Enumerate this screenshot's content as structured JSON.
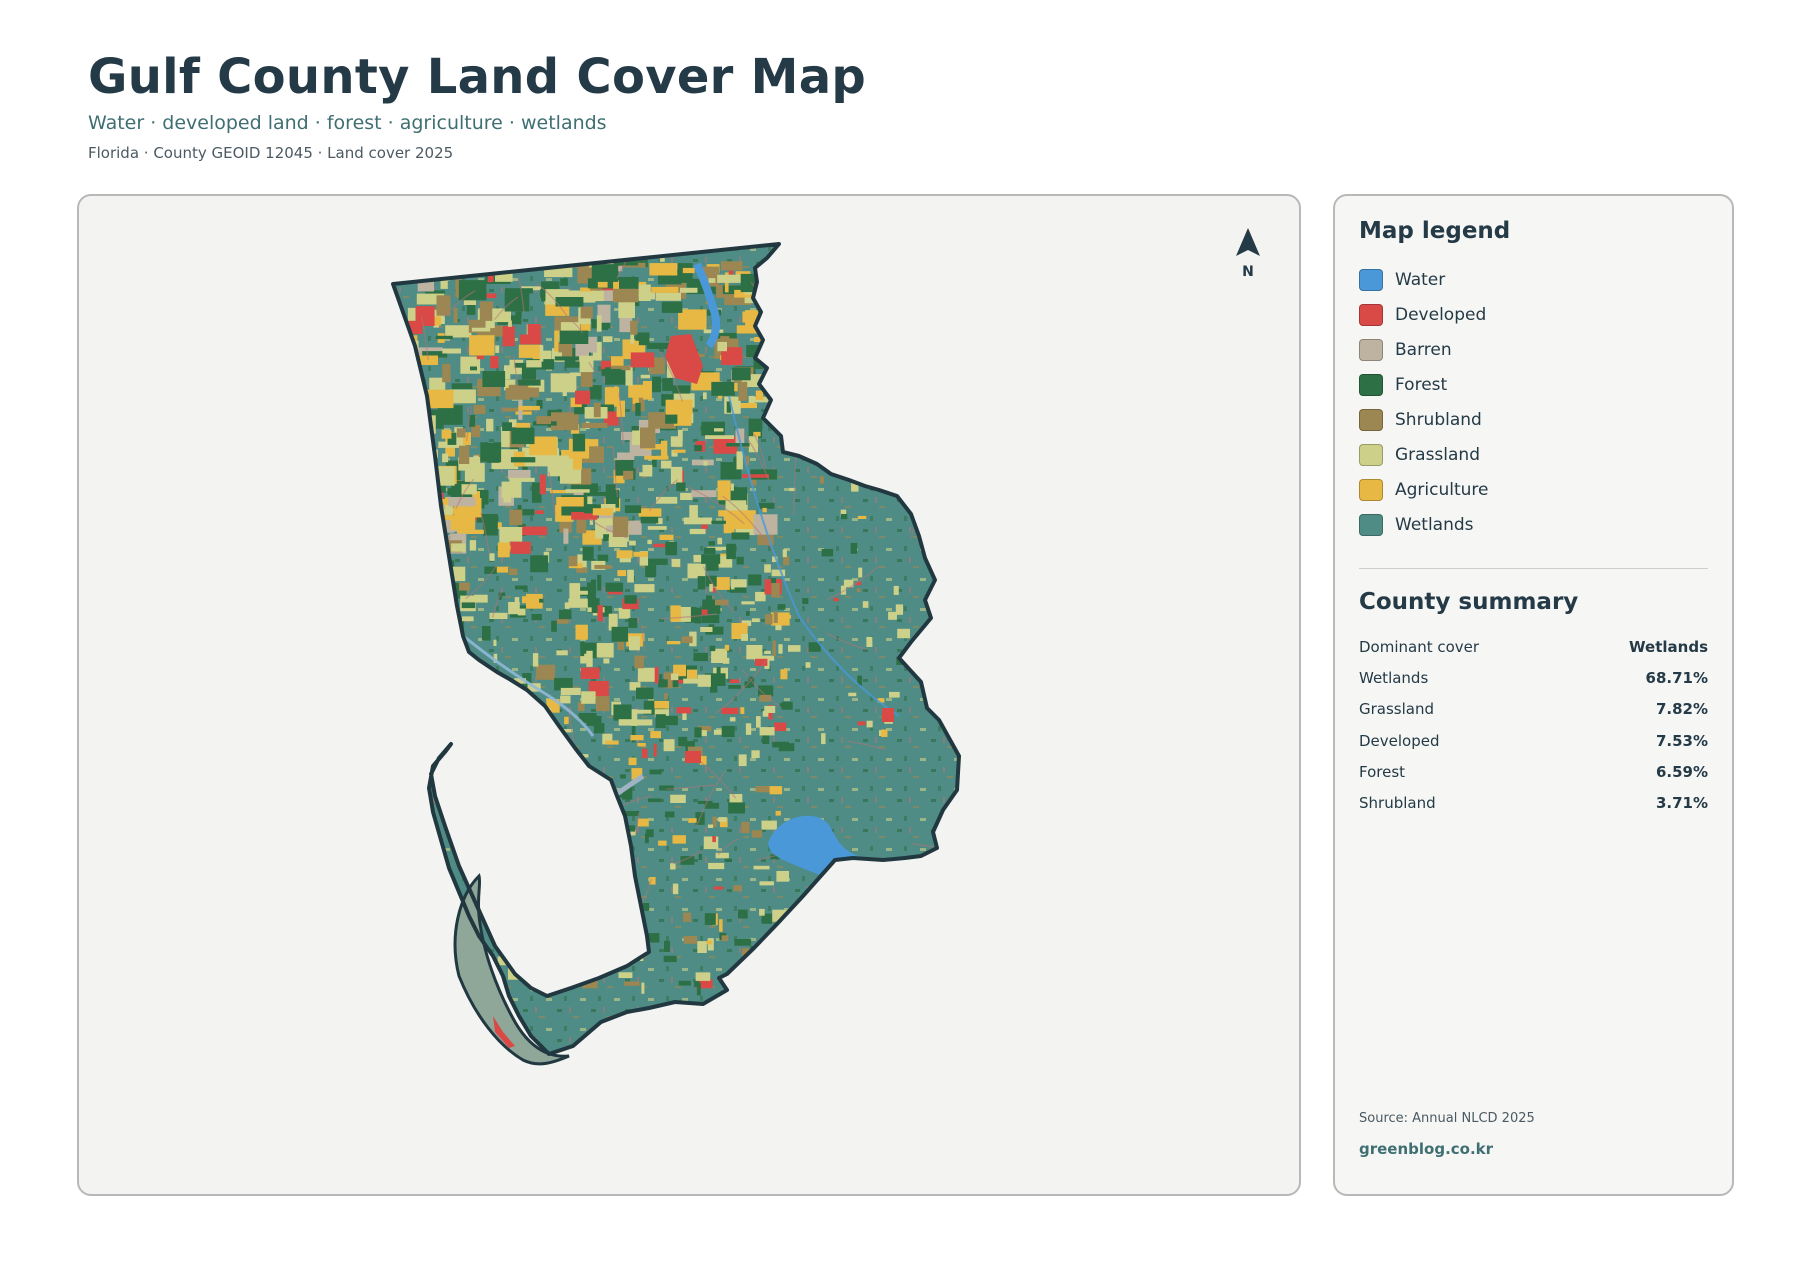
{
  "header": {
    "title": "Gulf County Land Cover Map",
    "subtitle": "Water · developed land · forest · agriculture · wetlands",
    "meta": "Florida · County GEOID 12045 · Land cover 2025"
  },
  "map": {
    "north_label": "N",
    "class_colors": {
      "water": "#4a98d8",
      "developed": "#d94a47",
      "barren": "#bdb3a0",
      "forest": "#2e7045",
      "shrubland": "#9c8752",
      "grassland": "#cdd088",
      "agriculture": "#e7b843",
      "wetlands": "#4f8c85"
    },
    "background": "#f3f3f2",
    "outline_color": "#223840"
  },
  "legend": {
    "heading": "Map legend",
    "items": [
      {
        "label": "Water",
        "color": "#4a98d8"
      },
      {
        "label": "Developed",
        "color": "#d94a47"
      },
      {
        "label": "Barren",
        "color": "#bdb3a0"
      },
      {
        "label": "Forest",
        "color": "#2e7045"
      },
      {
        "label": "Shrubland",
        "color": "#9c8752"
      },
      {
        "label": "Grassland",
        "color": "#cdd088"
      },
      {
        "label": "Agriculture",
        "color": "#e7b843"
      },
      {
        "label": "Wetlands",
        "color": "#4f8c85"
      }
    ]
  },
  "summary": {
    "heading": "County summary",
    "rows": [
      {
        "label": "Dominant cover",
        "value": "Wetlands"
      },
      {
        "label": "Wetlands",
        "value": "68.71%"
      },
      {
        "label": "Grassland",
        "value": "7.82%"
      },
      {
        "label": "Developed",
        "value": "7.53%"
      },
      {
        "label": "Forest",
        "value": "6.59%"
      },
      {
        "label": "Shrubland",
        "value": "3.71%"
      }
    ]
  },
  "footer": {
    "source": "Source: Annual NLCD 2025",
    "site": "greenblog.co.kr"
  }
}
